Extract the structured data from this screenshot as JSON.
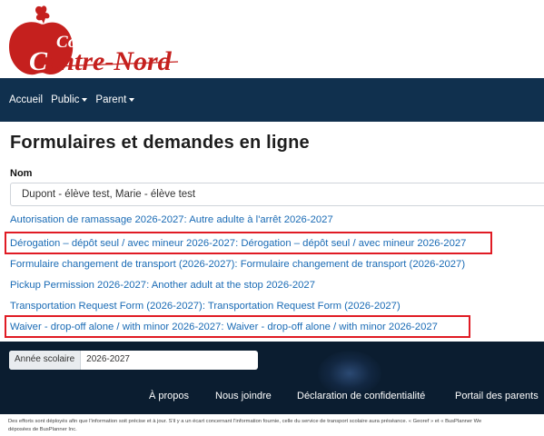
{
  "logo": {
    "line1": "Conseil scolaire",
    "line2_first": "C",
    "line2_rest": "entre-Nord",
    "colors": {
      "apple": "#c5201e",
      "leaf": "#c5201e"
    }
  },
  "nav": {
    "items": [
      {
        "label": "Accueil",
        "dropdown": false
      },
      {
        "label": "Public",
        "dropdown": true
      },
      {
        "label": "Parent",
        "dropdown": true
      }
    ]
  },
  "main": {
    "title": "Formulaires et demandes en ligne",
    "nom_label": "Nom",
    "nom_value": "Dupont - élève test, Marie - élève test",
    "links": [
      {
        "text": "Autorisation de ramassage 2026-2027: Autre adulte à l'arrêt 2026-2027",
        "highlighted": false
      },
      {
        "text": "Dérogation – dépôt seul / avec mineur 2026-2027: Dérogation – dépôt seul / avec mineur 2026-2027",
        "highlighted": true
      },
      {
        "text": "Formulaire changement de transport (2026-2027): Formulaire changement de transport (2026-2027)",
        "highlighted": false
      },
      {
        "text": "Pickup Permission 2026-2027: Another adult at the stop 2026-2027",
        "highlighted": false
      },
      {
        "text": "Transportation Request Form (2026-2027): Transportation Request Form (2026-2027)",
        "highlighted": false
      },
      {
        "text": "Waiver - drop-off alone / with minor 2026-2027: Waiver - drop-off alone / with minor 2026-2027",
        "highlighted": true
      }
    ],
    "colors": {
      "link": "#1a6bb5",
      "highlight_border": "#e01b24"
    }
  },
  "footer": {
    "year_label": "Année scolaire",
    "year_value": "2026-2027",
    "links": [
      "À propos",
      "Nous joindre",
      "Déclaration de confidentialité",
      "Portail des parents"
    ],
    "disclaimer_line1": "Des efforts sont déployés afin que l'information soit précise et à jour. S'il y a un écart concernant l'information fournie, celle du service de transport scolaire aura préséance. « Georef » et « BusPlanner We",
    "disclaimer_line2": "déposées de BusPlanner Inc.",
    "colors": {
      "navbar": "#10304e",
      "footer_bg": "#0b1d30"
    }
  }
}
